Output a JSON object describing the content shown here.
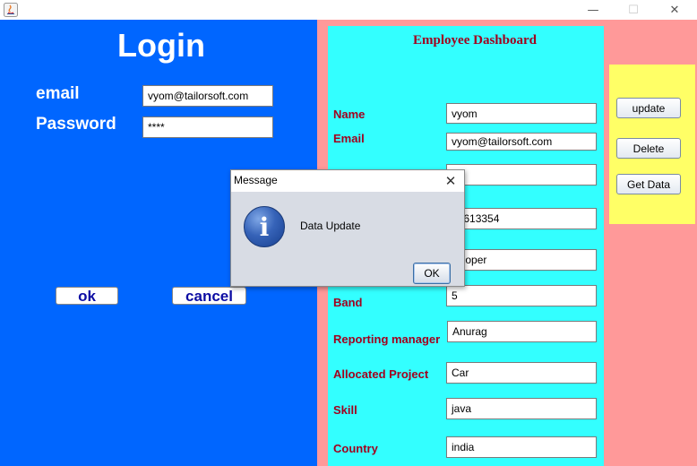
{
  "window": {
    "minimize_glyph": "—",
    "maximize_glyph": "☐",
    "close_glyph": "✕"
  },
  "login": {
    "title": "Login",
    "email_label": "email",
    "email_value": "vyom@tailorsoft.com",
    "password_label": "Password",
    "password_value": "****",
    "ok_label": "ok",
    "cancel_label": "cancel"
  },
  "dashboard": {
    "title": "Employee Dashboard",
    "fields": [
      {
        "label": "Name",
        "value": "vyom"
      },
      {
        "label": "Email",
        "value": "vyom@tailorsoft.com"
      },
      {
        "label": "",
        "value": "34"
      },
      {
        "label": "",
        "value": "15613354"
      },
      {
        "label": "",
        "value": "veloper"
      },
      {
        "label": "Band",
        "value": "5"
      },
      {
        "label": "Reporting manager",
        "value": "Anurag"
      },
      {
        "label": "Allocated Project",
        "value": "Car"
      },
      {
        "label": "Skill",
        "value": "java"
      },
      {
        "label": "Country",
        "value": "india"
      }
    ]
  },
  "actions": {
    "update_label": "update",
    "delete_label": "Delete",
    "get_data_label": "Get Data"
  },
  "dialog": {
    "title": "Message",
    "close_glyph": "✕",
    "icon_glyph": "i",
    "message": "Data Update",
    "ok_label": "OK"
  },
  "colors": {
    "login_panel": "#0066ff",
    "dashboard_panel": "#33ffff",
    "dashboard_labels": "#a1001e",
    "action_panel": "#ffff66",
    "window_background": "#ff9999"
  }
}
